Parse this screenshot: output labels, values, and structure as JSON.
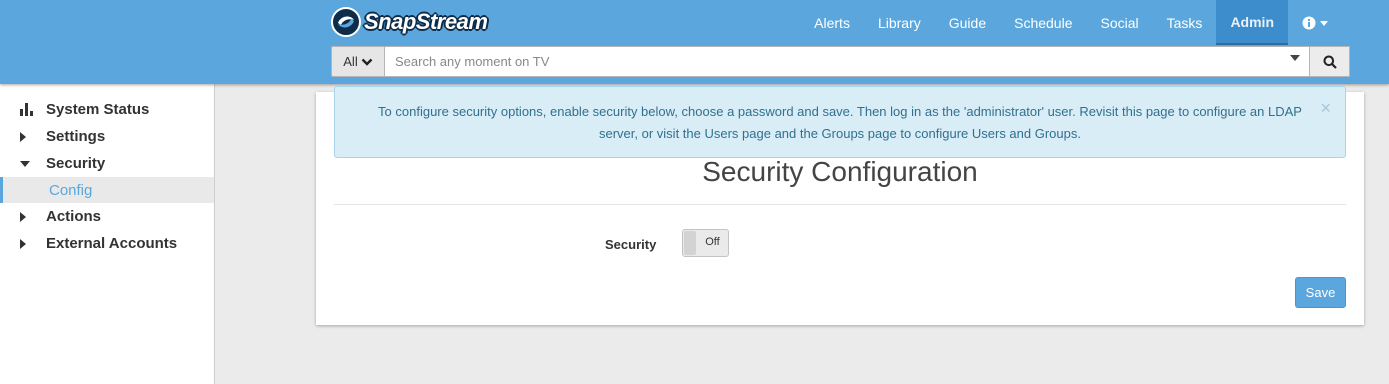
{
  "brand": {
    "name": "SnapStream",
    "logo_icon": "snapstream-logo-icon"
  },
  "nav": {
    "items": [
      {
        "label": "Alerts"
      },
      {
        "label": "Library"
      },
      {
        "label": "Guide"
      },
      {
        "label": "Schedule"
      },
      {
        "label": "Social"
      },
      {
        "label": "Tasks"
      },
      {
        "label": "Admin",
        "active": true
      }
    ],
    "info_icon": "info-circle-icon"
  },
  "search": {
    "scope_value": "All",
    "placeholder": "Search any moment on TV",
    "value": ""
  },
  "sidebar": {
    "items": [
      {
        "label": "System Status",
        "icon": "bar-chart-icon"
      },
      {
        "label": "Settings",
        "icon": "caret-right-icon"
      },
      {
        "label": "Security",
        "icon": "caret-down-icon",
        "expanded": true
      },
      {
        "label": "Config",
        "selected": true
      },
      {
        "label": "Actions",
        "icon": "caret-right-icon"
      },
      {
        "label": "External Accounts",
        "icon": "caret-right-icon"
      }
    ]
  },
  "alert": {
    "line1": "To configure security options, enable security below, choose a password and save. Then log in as the 'administrator' user. Revisit this page to configure an LDAP",
    "line2": "server, or visit the Users page and the Groups page to configure Users and Groups.",
    "close": "×"
  },
  "main": {
    "title": "Security Configuration",
    "security_label": "Security",
    "security_toggle": "Off",
    "save_label": "Save"
  },
  "colors": {
    "header": "#5ba7dd",
    "active_nav": "#3d8ccb",
    "alert_bg": "#d9edf7",
    "alert_text": "#31708f",
    "accent": "#5ba7dd"
  }
}
